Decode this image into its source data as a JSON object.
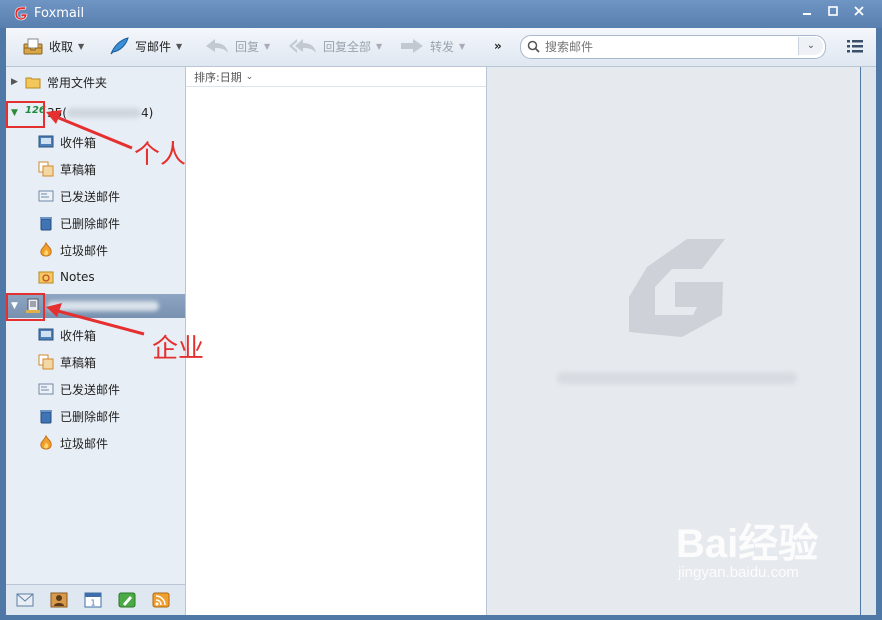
{
  "window": {
    "title": "Foxmail"
  },
  "toolbar": {
    "receive": "收取",
    "compose": "写邮件",
    "reply": "回复",
    "reply_all": "回复全部",
    "forward": "转发",
    "more": "»",
    "search_placeholder": "搜索邮件"
  },
  "sidebar": {
    "common_folder": "常用文件夹",
    "personal_account": {
      "icon": "126",
      "label_prefix": "35(",
      "label_suffix": "4)",
      "folders": [
        "收件箱",
        "草稿箱",
        "已发送邮件",
        "已删除邮件",
        "垃圾邮件",
        "Notes"
      ]
    },
    "business_account": {
      "folders": [
        "收件箱",
        "草稿箱",
        "已发送邮件",
        "已删除邮件",
        "垃圾邮件"
      ]
    }
  },
  "list": {
    "sort_label": "排序:日期"
  },
  "annotations": {
    "personal": "个人",
    "business": "企业"
  },
  "watermark": {
    "line1": "Bai经验",
    "line2": "jingyan.baidu.com"
  },
  "colors": {
    "annotation": "#e53030",
    "titlebar": "#587fae",
    "selected": "#7891b0"
  }
}
